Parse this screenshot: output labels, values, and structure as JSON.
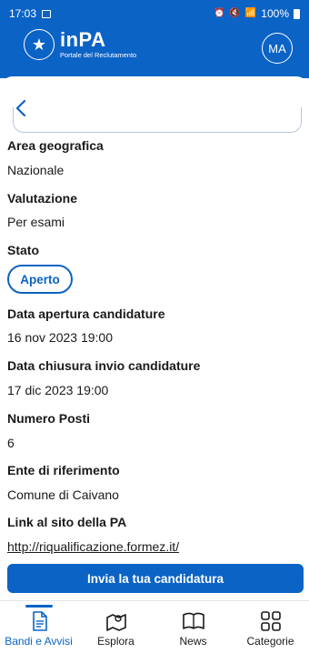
{
  "status_bar": {
    "time": "17:03",
    "battery": "100%"
  },
  "header": {
    "brand_name": "inPA",
    "brand_subtitle": "Portale del Reclutamento",
    "avatar_initials": "MA"
  },
  "details": [
    {
      "label": "Area geografica",
      "value": "Nazionale"
    },
    {
      "label": "Valutazione",
      "value": "Per esami"
    },
    {
      "label": "Stato",
      "value": "Aperto"
    },
    {
      "label": "Data apertura candidature",
      "value": "16 nov 2023 19:00"
    },
    {
      "label": "Data chiusura invio candidature",
      "value": "17 dic 2023 19:00"
    },
    {
      "label": "Numero Posti",
      "value": "6"
    },
    {
      "label": "Ente di riferimento",
      "value": "Comune di Caivano"
    },
    {
      "label": "Link al sito della PA",
      "value": "http://riqualificazione.formez.it/"
    }
  ],
  "cta": {
    "label": "Invia la tua candidatura"
  },
  "tabs": [
    {
      "label": "Bandi e Avvisi",
      "icon": "document-icon",
      "active": true
    },
    {
      "label": "Esplora",
      "icon": "map-icon",
      "active": false
    },
    {
      "label": "News",
      "icon": "book-icon",
      "active": false
    },
    {
      "label": "Categorie",
      "icon": "grid-icon",
      "active": false
    }
  ],
  "colors": {
    "primary": "#0b63c5",
    "text": "#1a1a1a",
    "border": "#b8c7da"
  }
}
